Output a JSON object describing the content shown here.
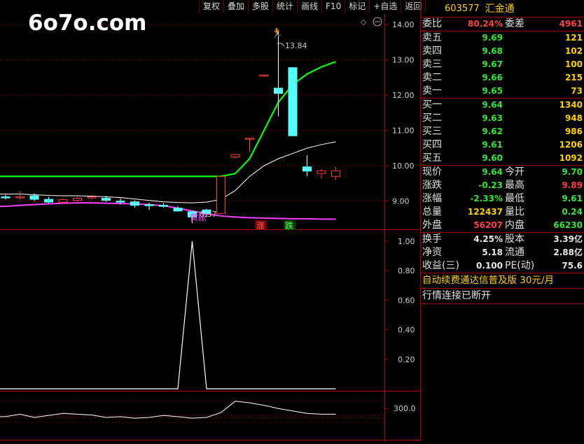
{
  "toolbar": {
    "items": [
      "复权",
      "叠加",
      "多股",
      "统计",
      "画线",
      "F10",
      "标记",
      "+自选",
      "返回"
    ]
  },
  "watermark": "6o7o.com",
  "chart": {
    "price_axis": [
      "14.00",
      "13.00",
      "12.00",
      "11.00",
      "10.00",
      "9.00"
    ],
    "high_label": "13.84",
    "low_label": "8.37",
    "signal_label": "黄胀",
    "zhang": "涨",
    "die": "跌",
    "ind1_axis": [
      "1.00",
      "0.80",
      "0.60",
      "0.40",
      "0.20"
    ],
    "ind2_axis": [
      "300.0"
    ],
    "colors": {
      "up": "#ff3c3c",
      "down": "#54ffff",
      "ma_green": "#00ff00",
      "ma_pink": "#ff40ff",
      "frame": "#b00000"
    }
  },
  "chart_data": {
    "type": "candlestick",
    "ylim": [
      8.2,
      14.3
    ],
    "candles": [
      {
        "o": 9.12,
        "h": 9.22,
        "l": 9.05,
        "c": 9.1
      },
      {
        "o": 9.1,
        "h": 9.28,
        "l": 9.05,
        "c": 9.12
      },
      {
        "o": 9.15,
        "h": 9.22,
        "l": 9.0,
        "c": 9.05
      },
      {
        "o": 9.05,
        "h": 9.12,
        "l": 8.92,
        "c": 8.97
      },
      {
        "o": 8.97,
        "h": 9.08,
        "l": 8.92,
        "c": 9.04
      },
      {
        "o": 9.02,
        "h": 9.12,
        "l": 8.98,
        "c": 9.08
      },
      {
        "o": 9.1,
        "h": 9.18,
        "l": 9.05,
        "c": 9.12
      },
      {
        "o": 9.08,
        "h": 9.15,
        "l": 8.98,
        "c": 9.02
      },
      {
        "o": 9.0,
        "h": 9.08,
        "l": 8.9,
        "c": 8.98
      },
      {
        "o": 8.98,
        "h": 9.02,
        "l": 8.82,
        "c": 8.88
      },
      {
        "o": 8.9,
        "h": 8.95,
        "l": 8.75,
        "c": 8.88
      },
      {
        "o": 8.88,
        "h": 8.95,
        "l": 8.82,
        "c": 8.85
      },
      {
        "o": 8.8,
        "h": 8.85,
        "l": 8.7,
        "c": 8.72
      },
      {
        "o": 8.7,
        "h": 8.72,
        "l": 8.37,
        "c": 8.55
      },
      {
        "o": 8.75,
        "h": 8.78,
        "l": 8.55,
        "c": 8.65
      },
      {
        "o": 8.65,
        "h": 9.72,
        "l": 8.62,
        "c": 9.7
      },
      {
        "o": 10.25,
        "h": 10.32,
        "l": 10.2,
        "c": 10.32
      },
      {
        "o": 10.75,
        "h": 10.8,
        "l": 10.4,
        "c": 10.78
      },
      {
        "o": 12.55,
        "h": 12.58,
        "l": 12.52,
        "c": 12.57
      },
      {
        "o": 12.2,
        "h": 13.84,
        "l": 11.4,
        "c": 12.05
      },
      {
        "o": 12.78,
        "h": 12.78,
        "l": 10.85,
        "c": 10.85
      },
      {
        "o": 9.97,
        "h": 10.3,
        "l": 9.7,
        "c": 9.85
      },
      {
        "o": 9.78,
        "h": 9.9,
        "l": 9.63,
        "c": 9.86
      },
      {
        "o": 9.7,
        "h": 9.97,
        "l": 9.6,
        "c": 9.86
      }
    ],
    "ma_green": [
      9.7,
      9.7,
      9.7,
      9.7,
      9.7,
      9.7,
      9.7,
      9.7,
      9.7,
      9.7,
      9.7,
      9.7,
      9.7,
      9.7,
      9.7,
      9.7,
      9.78,
      10.2,
      11.0,
      11.8,
      12.3,
      12.6,
      12.8,
      12.95
    ],
    "ma_white": [
      9.2,
      9.2,
      9.18,
      9.16,
      9.15,
      9.15,
      9.14,
      9.12,
      9.1,
      9.06,
      9.02,
      8.98,
      8.96,
      8.95,
      8.97,
      9.05,
      9.3,
      9.7,
      10.0,
      10.2,
      10.35,
      10.5,
      10.6,
      10.68
    ],
    "ma_pink": [
      8.85,
      8.88,
      8.9,
      8.92,
      8.94,
      8.95,
      8.95,
      8.94,
      8.93,
      8.92,
      8.9,
      8.87,
      8.8,
      8.72,
      8.64,
      8.58,
      8.55,
      8.53,
      8.52,
      8.51,
      8.5,
      8.5,
      8.49,
      8.49
    ],
    "indicator1": [
      0,
      0,
      0,
      0,
      0,
      0,
      0,
      0,
      0,
      0,
      0,
      0,
      0,
      1.0,
      0,
      0,
      0,
      0,
      0,
      0,
      0,
      0,
      0,
      0
    ],
    "indicator2": [
      0.52,
      0.58,
      0.5,
      0.55,
      0.6,
      0.58,
      0.56,
      0.5,
      0.52,
      0.48,
      0.5,
      0.55,
      0.52,
      0.48,
      0.5,
      0.62,
      0.9,
      0.86,
      0.8,
      0.72,
      0.66,
      0.6,
      0.58,
      0.58
    ]
  },
  "quote": {
    "code": "603577",
    "name": "汇金通",
    "weibi_label": "委比",
    "weibi": "80.24%",
    "weicha_label": "委差",
    "weicha": "4961",
    "sells": [
      {
        "label": "卖五",
        "price": "9.69",
        "vol": "121"
      },
      {
        "label": "卖四",
        "price": "9.68",
        "vol": "102"
      },
      {
        "label": "卖三",
        "price": "9.67",
        "vol": "100"
      },
      {
        "label": "卖二",
        "price": "9.66",
        "vol": "215"
      },
      {
        "label": "卖一",
        "price": "9.65",
        "vol": "73"
      }
    ],
    "buys": [
      {
        "label": "买一",
        "price": "9.64",
        "vol": "1340"
      },
      {
        "label": "买二",
        "price": "9.63",
        "vol": "948"
      },
      {
        "label": "买三",
        "price": "9.62",
        "vol": "986"
      },
      {
        "label": "买四",
        "price": "9.61",
        "vol": "1206"
      },
      {
        "label": "买五",
        "price": "9.60",
        "vol": "1092"
      }
    ],
    "stats1": [
      {
        "l1": "现价",
        "v1": "9.64",
        "c1": "green",
        "l2": "今开",
        "v2": "9.70",
        "c2": "green"
      },
      {
        "l1": "涨跌",
        "v1": "-0.23",
        "c1": "green",
        "l2": "最高",
        "v2": "9.89",
        "c2": "red"
      },
      {
        "l1": "涨幅",
        "v1": "-2.33%",
        "c1": "green",
        "l2": "最低",
        "v2": "9.61",
        "c2": "green"
      },
      {
        "l1": "总量",
        "v1": "122437",
        "c1": "yellow",
        "l2": "量比",
        "v2": "0.24",
        "c2": "green"
      },
      {
        "l1": "外盘",
        "v1": "56207",
        "c1": "red",
        "l2": "内盘",
        "v2": "66230",
        "c2": "green"
      }
    ],
    "stats2": [
      {
        "l1": "换手",
        "v1": "4.25%",
        "c1": "white",
        "l2": "股本",
        "v2": "3.39亿",
        "c2": "white"
      },
      {
        "l1": "净资",
        "v1": "5.18",
        "c1": "white",
        "l2": "流通",
        "v2": "2.88亿",
        "c2": "white"
      },
      {
        "l1": "收益(三)",
        "v1": "0.100",
        "c1": "white",
        "l2": "PE(动)",
        "v2": "75.6",
        "c2": "white"
      }
    ],
    "ad": "自动续费通达信普及版  30元/月",
    "status": "行情连接已断开"
  }
}
